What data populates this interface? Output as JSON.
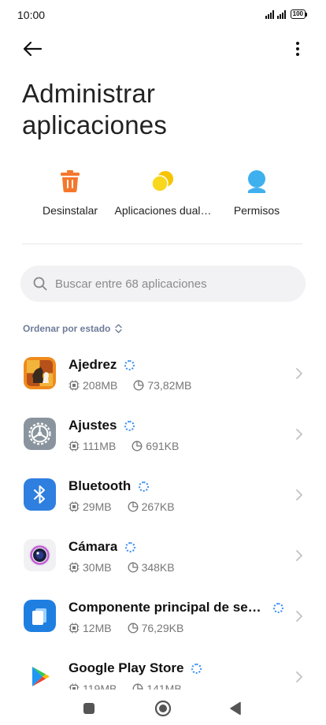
{
  "status": {
    "time": "10:00",
    "battery": "100"
  },
  "page": {
    "title": "Administrar aplicaciones"
  },
  "actions": [
    {
      "label": "Desinstalar",
      "icon": "trash-icon"
    },
    {
      "label": "Aplicaciones dual…",
      "icon": "dual-apps-icon"
    },
    {
      "label": "Permisos",
      "icon": "permissions-icon"
    }
  ],
  "search": {
    "placeholder": "Buscar entre 68 aplicaciones",
    "value": ""
  },
  "sort": {
    "label": "Ordenar por estado"
  },
  "apps": [
    {
      "name": "Ajedrez",
      "size": "208MB",
      "data": "73,82MB",
      "icon": "chess-app-icon"
    },
    {
      "name": "Ajustes",
      "size": "111MB",
      "data": "691KB",
      "icon": "settings-app-icon"
    },
    {
      "name": "Bluetooth",
      "size": "29MB",
      "data": "267KB",
      "icon": "bluetooth-app-icon"
    },
    {
      "name": "Cámara",
      "size": "30MB",
      "data": "348KB",
      "icon": "camera-app-icon"
    },
    {
      "name": "Componente principal de seg…",
      "size": "12MB",
      "data": "76,29KB",
      "icon": "security-component-app-icon"
    },
    {
      "name": "Google Play Store",
      "size": "119MB",
      "data": "141MB",
      "icon": "play-store-app-icon"
    }
  ],
  "colors": {
    "accent": "#3b8ff3",
    "uninstall": "#f5772b",
    "dual": "#f7c400",
    "permissions": "#3fb0ee"
  }
}
